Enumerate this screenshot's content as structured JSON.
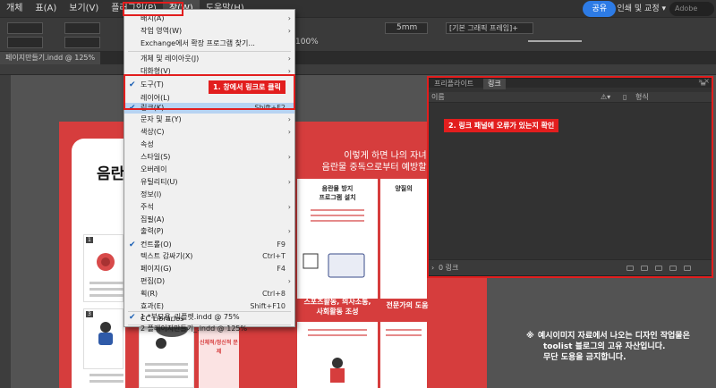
{
  "menubar": {
    "items": [
      "개체",
      "표(A)",
      "보기(V)",
      "플러그인(P)",
      "창(W)",
      "도움말(H)"
    ],
    "share": "공유",
    "workspace": "인쇄 및 교정",
    "search_placeholder": "Adobe"
  },
  "controlbar": {
    "stroke_weight": "5mm",
    "zoom": "100%",
    "frame_style": "[기본 그래픽 프레임]+"
  },
  "document_tab": "페이지만들기.indd @ 125%",
  "window_menu": {
    "items": [
      {
        "label": "배치(A)",
        "shortcut": "",
        "submenu": true,
        "checked": false
      },
      {
        "label": "작업 영역(W)",
        "shortcut": "",
        "submenu": true,
        "checked": false
      },
      {
        "label": "Exchange에서 확장 프로그램 찾기...",
        "shortcut": "",
        "submenu": false,
        "checked": false
      },
      {
        "label": "개체 및 레이아웃(J)",
        "shortcut": "",
        "submenu": true,
        "checked": false
      },
      {
        "label": "대화형(V)",
        "shortcut": "",
        "submenu": true,
        "checked": false
      },
      {
        "label": "도구(T)",
        "shortcut": "",
        "submenu": false,
        "checked": true
      },
      {
        "label": "레이어(L)",
        "shortcut": "",
        "submenu": false,
        "checked": false
      },
      {
        "label": "링크(K)",
        "shortcut": "Shift+F2",
        "submenu": false,
        "checked": true
      },
      {
        "label": "문자 및 표(Y)",
        "shortcut": "",
        "submenu": true,
        "checked": false
      },
      {
        "label": "색상(C)",
        "shortcut": "",
        "submenu": true,
        "checked": false
      },
      {
        "label": "속성",
        "shortcut": "",
        "submenu": false,
        "checked": false
      },
      {
        "label": "스타일(S)",
        "shortcut": "",
        "submenu": true,
        "checked": false
      },
      {
        "label": "오버레이",
        "shortcut": "",
        "submenu": false,
        "checked": false
      },
      {
        "label": "유틸리티(U)",
        "shortcut": "",
        "submenu": true,
        "checked": false
      },
      {
        "label": "정보(I)",
        "shortcut": "",
        "submenu": false,
        "checked": false
      },
      {
        "label": "주석",
        "shortcut": "",
        "submenu": true,
        "checked": false
      },
      {
        "label": "집필(A)",
        "shortcut": "",
        "submenu": false,
        "checked": false
      },
      {
        "label": "출력(P)",
        "shortcut": "",
        "submenu": true,
        "checked": false
      },
      {
        "label": "컨트롤(O)",
        "shortcut": "F9",
        "submenu": false,
        "checked": true
      },
      {
        "label": "텍스트 감싸기(X)",
        "shortcut": "Ctrl+T",
        "submenu": false,
        "checked": false
      },
      {
        "label": "페이지(G)",
        "shortcut": "F4",
        "submenu": false,
        "checked": false
      },
      {
        "label": "편집(D)",
        "shortcut": "",
        "submenu": true,
        "checked": false
      },
      {
        "label": "획(R)",
        "shortcut": "Ctrl+8",
        "submenu": false,
        "checked": false
      },
      {
        "label": "효과(E)",
        "shortcut": "Shift+F10",
        "submenu": false,
        "checked": false
      },
      {
        "label": "CC Libraries",
        "shortcut": "",
        "submenu": false,
        "checked": false
      },
      {
        "label": "1 *부모용_리플렛.indd @ 75%",
        "shortcut": "",
        "submenu": false,
        "checked": true
      },
      {
        "label": "2 플레이지만들기_.indd @ 125%",
        "shortcut": "",
        "submenu": false,
        "checked": false
      }
    ]
  },
  "callouts": {
    "step1": "1. 창에서 링크로 클릭",
    "step2": "2. 링크 패널에 오류가 있는지 확인"
  },
  "links_panel": {
    "tabs": [
      "프리플라이트",
      "링크"
    ],
    "col_name": "이름",
    "col_format": "형식",
    "footer_count": "0 링크",
    "menu_icon": "panel-menu-icon"
  },
  "document": {
    "left_heading": "음란",
    "headline_line1": "이렇게 하면 나의 자녀를",
    "headline_line2": "음란물 중독으로부터 예방할 수 있을",
    "card1_title": "음란물 방지\n프로그램 설치",
    "card2_title": "양질의",
    "card3_title": "스포츠활동, 의사소통,\n사회활동 조성",
    "card4_title": "전문가의 도움",
    "sub_label": "신체적/정신적 문제",
    "thumb_numbers": [
      "1",
      "3"
    ]
  },
  "notice": {
    "mark": "※",
    "lines": [
      "예시이미지 자료에서 나오는 디자인 작업물은",
      "toolist 블로그의 고유 자산입니다.",
      "무단 도용을 금지합니다."
    ]
  },
  "colors": {
    "accent_red": "#e21e1e",
    "doc_red": "#d63d3d",
    "share_blue": "#2d7be5",
    "highlight": "#b7d3f2"
  }
}
